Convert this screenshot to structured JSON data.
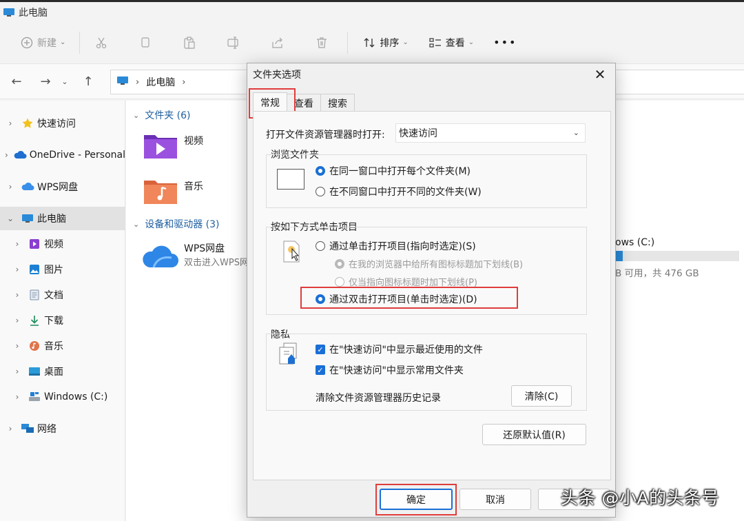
{
  "window": {
    "title": "此电脑"
  },
  "toolbar": {
    "new_label": "新建",
    "sort_label": "排序",
    "view_label": "查看",
    "more_label": "•••"
  },
  "address": {
    "location": "此电脑"
  },
  "sidebar": {
    "items": [
      {
        "label": "快速访问"
      },
      {
        "label": "OneDrive - Personal"
      },
      {
        "label": "WPS网盘"
      },
      {
        "label": "此电脑"
      },
      {
        "label": "视频"
      },
      {
        "label": "图片"
      },
      {
        "label": "文档"
      },
      {
        "label": "下载"
      },
      {
        "label": "音乐"
      },
      {
        "label": "桌面"
      },
      {
        "label": "Windows (C:)"
      },
      {
        "label": "网络"
      }
    ]
  },
  "main": {
    "folders_header": "文件夹 (6)",
    "folders": [
      {
        "name": "视频"
      },
      {
        "name": "音乐"
      }
    ],
    "devices_header": "设备和驱动器 (3)",
    "wps": {
      "name": "WPS网盘",
      "sub": "双击进入WPS网"
    },
    "drive": {
      "name": "ows (C:)",
      "space": "B 可用，共 476 GB",
      "used_fraction": 0.06
    }
  },
  "dialog": {
    "title": "文件夹选项",
    "tabs": [
      "常规",
      "查看",
      "搜索"
    ],
    "open_label": "打开文件资源管理器时打开:",
    "open_value": "快速访问",
    "browse_group": "浏览文件夹",
    "browse_same": "在同一窗口中打开每个文件夹(M)",
    "browse_diff": "在不同窗口中打开不同的文件夹(W)",
    "click_group": "按如下方式单击项目",
    "single_click": "通过单击打开项目(指向时选定)(S)",
    "underline_all": "在我的浏览器中给所有图标标题加下划线(B)",
    "underline_point": "仅当指向图标标题时加下划线(P)",
    "double_click": "通过双击打开项目(单击时选定)(D)",
    "privacy_group": "隐私",
    "show_recent": "在\"快速访问\"中显示最近使用的文件",
    "show_frequent": "在\"快速访问\"中显示常用文件夹",
    "clear_label": "清除文件资源管理器历史记录",
    "clear_button": "清除(C)",
    "restore_button": "还原默认值(R)",
    "ok_button": "确定",
    "cancel_button": "取消"
  },
  "watermark": "头条 @小A的头条号",
  "colors": {
    "accent": "#1a6fd6",
    "highlight": "#e03b3b"
  }
}
